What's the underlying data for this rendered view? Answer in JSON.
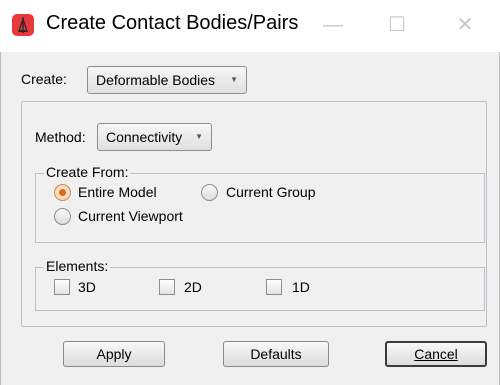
{
  "window": {
    "title": "Create Contact Bodies/Pairs",
    "controls": {
      "minimize": "—",
      "maximize": "☐",
      "close": "✕"
    }
  },
  "create": {
    "label": "Create:",
    "selected": "Deformable Bodies"
  },
  "method": {
    "label": "Method:",
    "selected": "Connectivity"
  },
  "create_from": {
    "title": "Create From:",
    "options": [
      {
        "label": "Entire Model",
        "checked": true
      },
      {
        "label": "Current Group",
        "checked": false
      },
      {
        "label": "Current Viewport",
        "checked": false
      }
    ]
  },
  "elements": {
    "title": "Elements:",
    "options": [
      {
        "label": "3D",
        "checked": false
      },
      {
        "label": "2D",
        "checked": false
      },
      {
        "label": "1D",
        "checked": false
      }
    ]
  },
  "buttons": {
    "apply": "Apply",
    "defaults": "Defaults",
    "cancel": "Cancel"
  },
  "colors": {
    "app_icon": "#e8383d",
    "radio_checked": "#e0661a",
    "dialog_bg": "#f0f0f0"
  }
}
